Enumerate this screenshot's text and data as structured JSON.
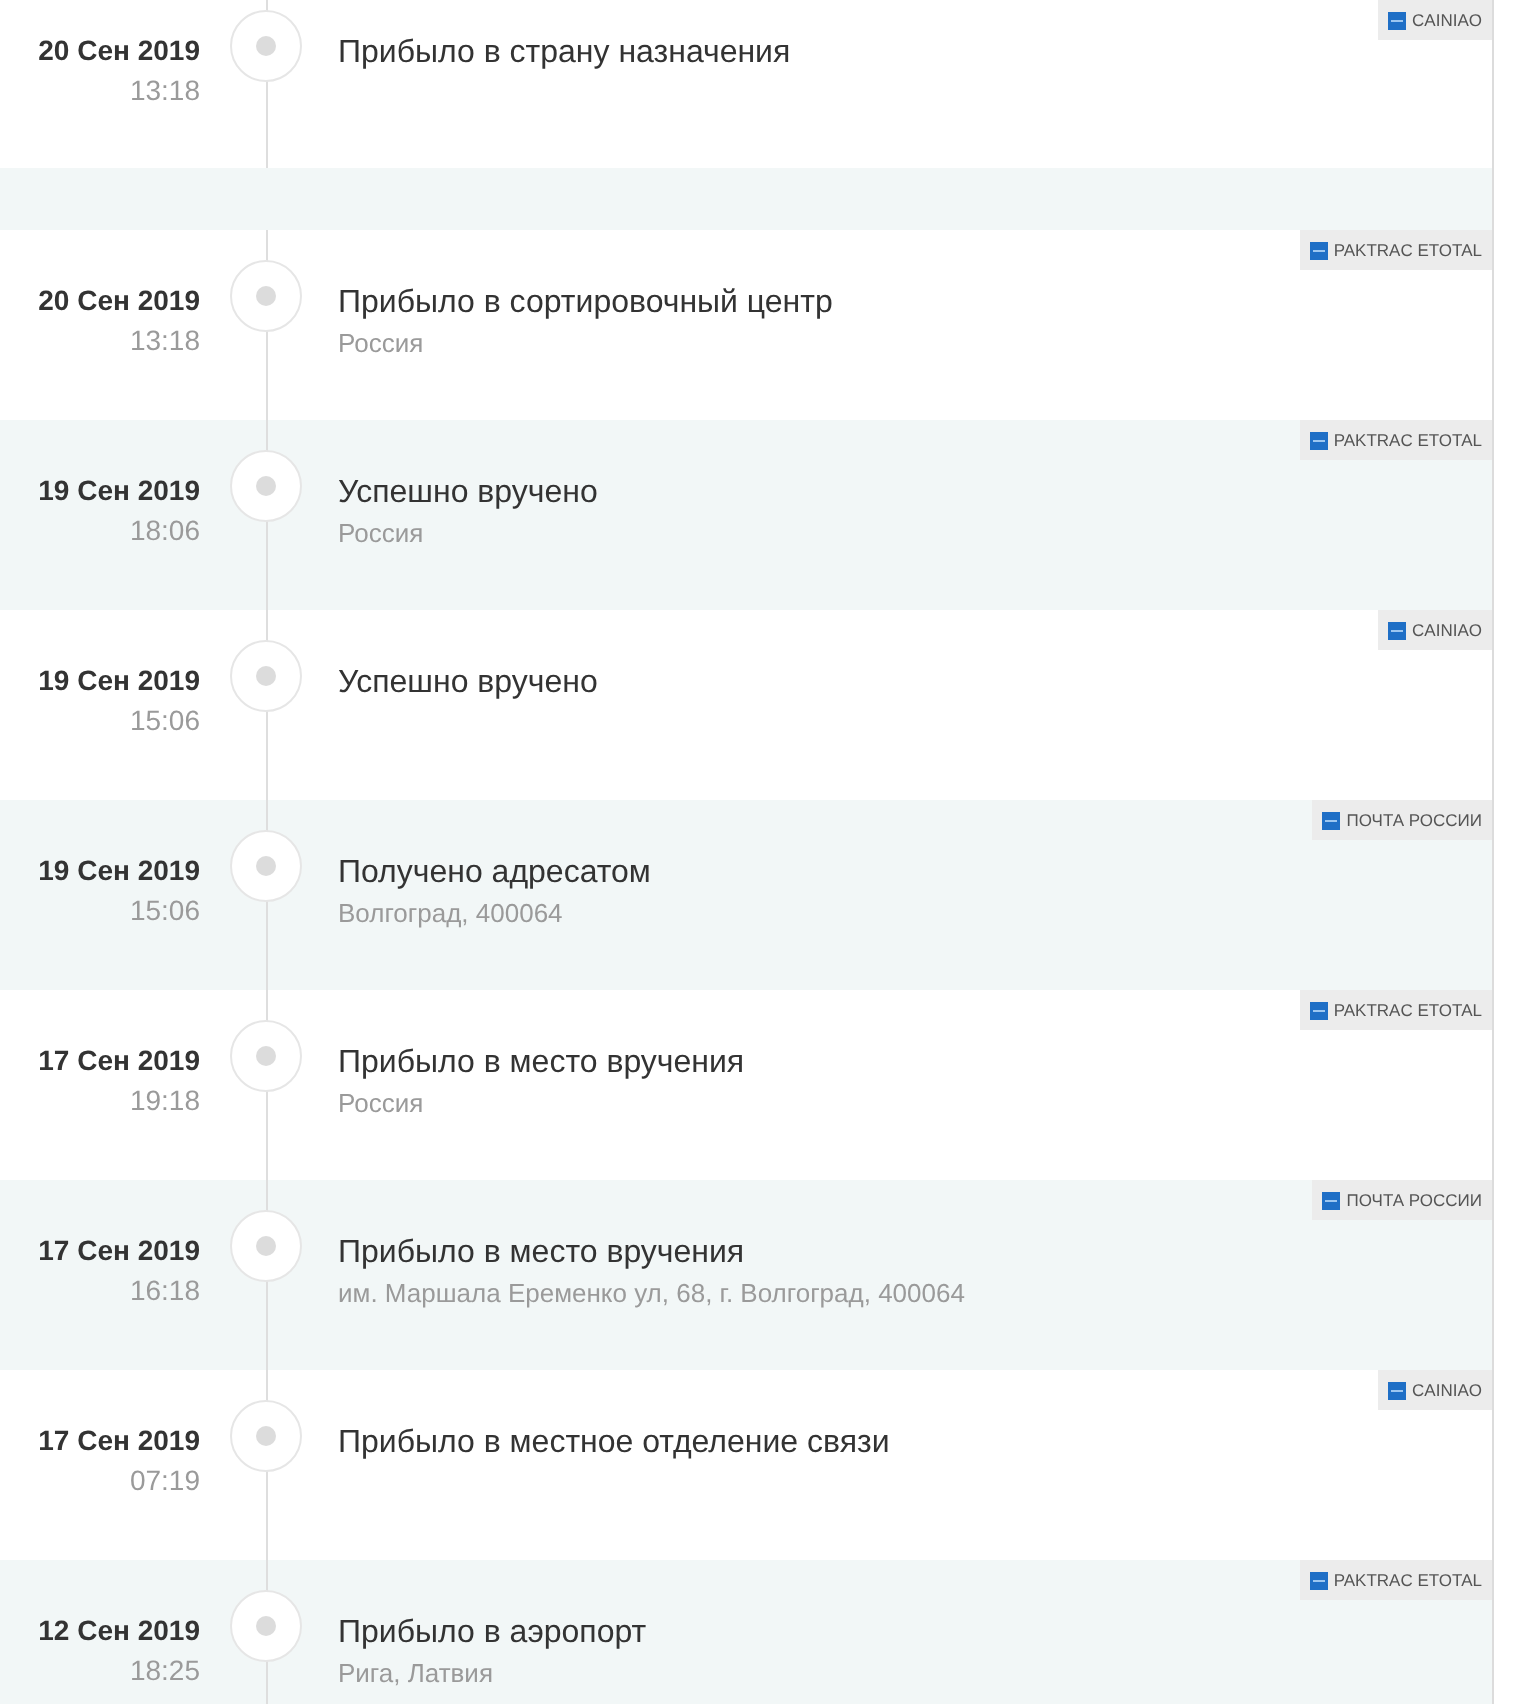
{
  "groups": [
    {
      "events": [
        {
          "date": "20 Сен 2019",
          "time": "13:18",
          "status": "Прибыло в страну назначения",
          "carrier": "CAINIAO"
        }
      ]
    },
    {
      "events": [
        {
          "date": "20 Сен 2019",
          "time": "13:18",
          "status": "Прибыло в сортировочный центр",
          "location": "Россия",
          "carrier": "PAKTRAC ETOTAL"
        },
        {
          "date": "19 Сен 2019",
          "time": "18:06",
          "status": "Успешно вручено",
          "location": "Россия",
          "carrier": "PAKTRAC ETOTAL"
        },
        {
          "date": "19 Сен 2019",
          "time": "15:06",
          "status": "Успешно вручено",
          "carrier": "CAINIAO"
        },
        {
          "date": "19 Сен 2019",
          "time": "15:06",
          "status": "Получено адресатом",
          "location": "Волгоград, 400064",
          "carrier": "ПОЧТА РОССИИ"
        },
        {
          "date": "17 Сен 2019",
          "time": "19:18",
          "status": "Прибыло в место вручения",
          "location": "Россия",
          "carrier": "PAKTRAC ETOTAL"
        },
        {
          "date": "17 Сен 2019",
          "time": "16:18",
          "status": "Прибыло в место вручения",
          "location": "им. Маршала Еременко ул, 68, г. Волгоград, 400064",
          "carrier": "ПОЧТА РОССИИ"
        },
        {
          "date": "17 Сен 2019",
          "time": "07:19",
          "status": "Прибыло в местное отделение связи",
          "carrier": "CAINIAO"
        },
        {
          "date": "12 Сен 2019",
          "time": "18:25",
          "status": "Прибыло в аэропорт",
          "location": "Рига, Латвия",
          "carrier": "PAKTRAC ETOTAL"
        }
      ]
    }
  ]
}
